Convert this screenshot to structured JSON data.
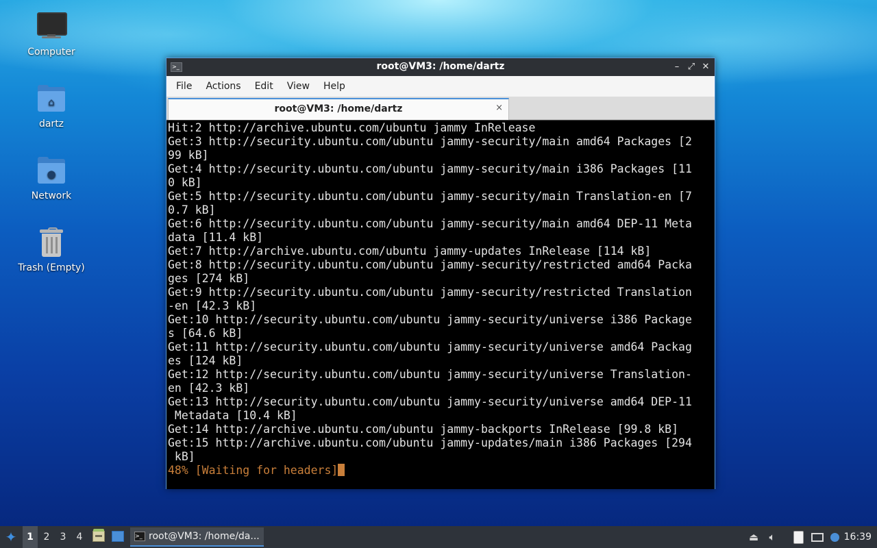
{
  "desktop": {
    "icons": [
      {
        "label": "Computer",
        "icon": "computer-icon"
      },
      {
        "label": "dartz",
        "icon": "home-folder-icon"
      },
      {
        "label": "Network",
        "icon": "network-folder-icon"
      },
      {
        "label": "Trash (Empty)",
        "icon": "trash-icon"
      }
    ]
  },
  "window": {
    "title": "root@VM3: /home/dartz",
    "menu": [
      "File",
      "Actions",
      "Edit",
      "View",
      "Help"
    ],
    "tab": {
      "title": "root@VM3: /home/dartz",
      "close": "×"
    },
    "buttons": {
      "minimize": "–",
      "maximize": "⤢",
      "close": "✕"
    }
  },
  "terminal": {
    "lines": [
      "Hit:2 http://archive.ubuntu.com/ubuntu jammy InRelease",
      "Get:3 http://security.ubuntu.com/ubuntu jammy-security/main amd64 Packages [2",
      "99 kB]",
      "Get:4 http://security.ubuntu.com/ubuntu jammy-security/main i386 Packages [11",
      "0 kB]",
      "Get:5 http://security.ubuntu.com/ubuntu jammy-security/main Translation-en [7",
      "0.7 kB]",
      "Get:6 http://security.ubuntu.com/ubuntu jammy-security/main amd64 DEP-11 Meta",
      "data [11.4 kB]",
      "Get:7 http://archive.ubuntu.com/ubuntu jammy-updates InRelease [114 kB]",
      "Get:8 http://security.ubuntu.com/ubuntu jammy-security/restricted amd64 Packa",
      "ges [274 kB]",
      "Get:9 http://security.ubuntu.com/ubuntu jammy-security/restricted Translation",
      "-en [42.3 kB]",
      "Get:10 http://security.ubuntu.com/ubuntu jammy-security/universe i386 Package",
      "s [64.6 kB]",
      "Get:11 http://security.ubuntu.com/ubuntu jammy-security/universe amd64 Packag",
      "es [124 kB]",
      "Get:12 http://security.ubuntu.com/ubuntu jammy-security/universe Translation-",
      "en [42.3 kB]",
      "Get:13 http://security.ubuntu.com/ubuntu jammy-security/universe amd64 DEP-11",
      " Metadata [10.4 kB]",
      "Get:14 http://archive.ubuntu.com/ubuntu jammy-backports InRelease [99.8 kB]",
      "Get:15 http://archive.ubuntu.com/ubuntu jammy-updates/main i386 Packages [294",
      " kB]"
    ],
    "progress_line": "48% [Waiting for headers]",
    "progress_color": "#c97f3a"
  },
  "taskbar": {
    "workspaces": [
      "1",
      "2",
      "3",
      "4"
    ],
    "active_workspace": "1",
    "task_label": "root@VM3: /home/da...",
    "clock": "16:39",
    "tray_icons": [
      "upload-icon",
      "volume-icon",
      "clipboard-icon",
      "network-icon",
      "notification-icon"
    ]
  }
}
